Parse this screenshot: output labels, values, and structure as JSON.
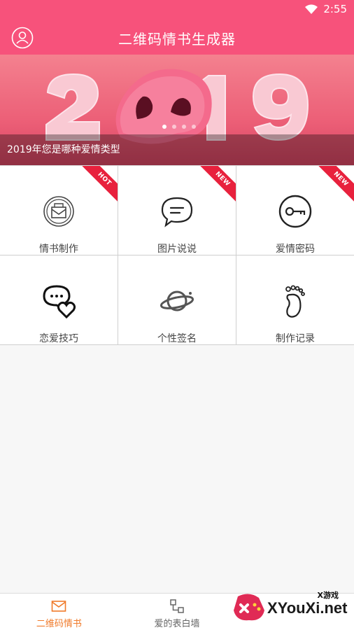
{
  "status_bar": {
    "time": "2:55"
  },
  "app_bar": {
    "title": "二维码情书生成器"
  },
  "banner": {
    "caption": "2019年您是哪种爱情类型",
    "pages": 4,
    "active_page": 1
  },
  "features": [
    {
      "label": "情书制作",
      "icon": "envelope-icon",
      "badge": "HOT"
    },
    {
      "label": "图片说说",
      "icon": "chat-bubble-icon",
      "badge": "NEW"
    },
    {
      "label": "爱情密码",
      "icon": "key-icon",
      "badge": "NEW"
    },
    {
      "label": "恋爱技巧",
      "icon": "heart-chat-icon",
      "badge": ""
    },
    {
      "label": "个性签名",
      "icon": "planet-icon",
      "badge": ""
    },
    {
      "label": "制作记录",
      "icon": "footprint-icon",
      "badge": ""
    }
  ],
  "bottom_nav": [
    {
      "label": "二维码情书",
      "icon": "mail-icon",
      "active": true
    },
    {
      "label": "爱的表白墙",
      "icon": "wall-icon",
      "active": false
    }
  ],
  "watermark": {
    "text": "XYouXi.net",
    "small": "X游戏"
  },
  "colors": {
    "primary": "#f7527b",
    "accent": "#f07a2a",
    "ribbon": "#e8213d"
  }
}
